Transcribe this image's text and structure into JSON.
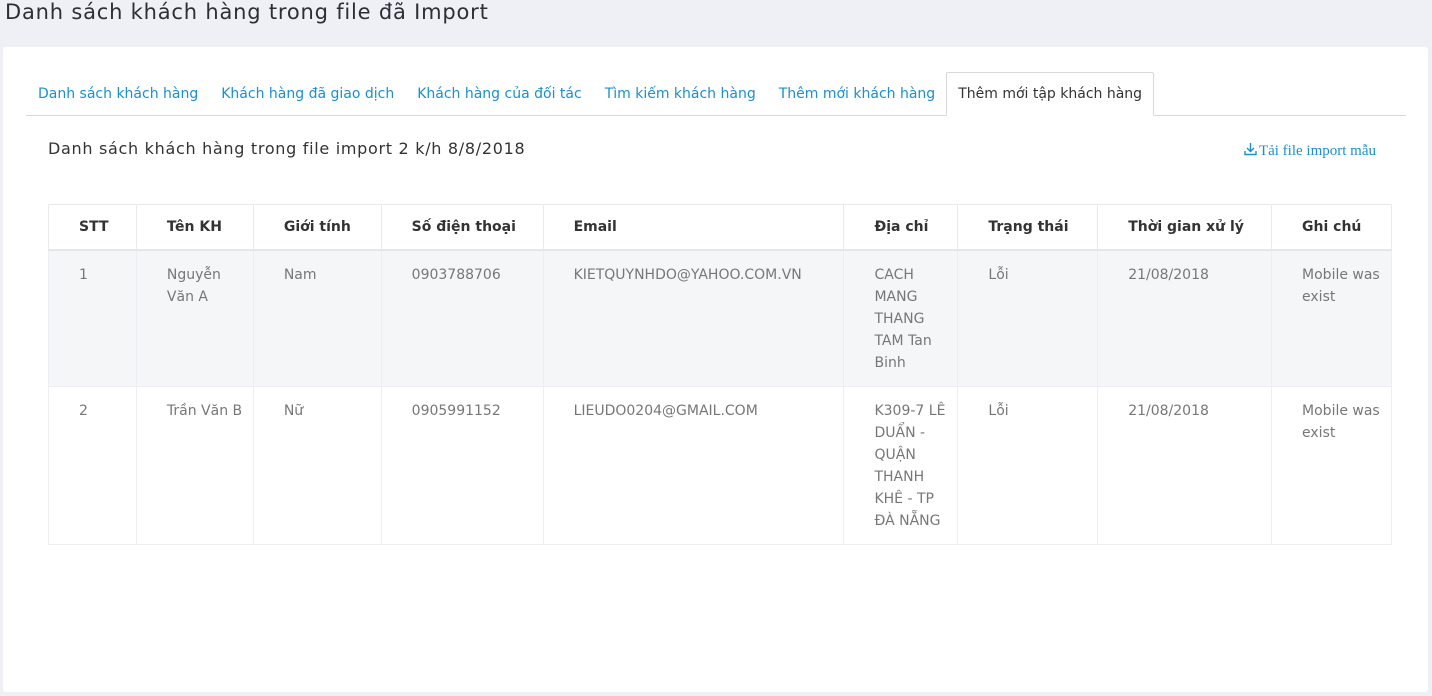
{
  "page_title": "Danh sách khách hàng trong file đã Import",
  "tabs": [
    {
      "label": "Danh sách khách hàng"
    },
    {
      "label": "Khách hàng đã giao dịch"
    },
    {
      "label": "Khách hàng của đối tác"
    },
    {
      "label": "Tìm kiếm khách hàng"
    },
    {
      "label": "Thêm mới khách hàng"
    },
    {
      "label": "Thêm mới tập khách hàng"
    }
  ],
  "subtitle": "Danh sách khách hàng trong file import 2 k/h 8/8/2018",
  "download_link": {
    "label": "Tải file import mẫu",
    "icon": "download-icon"
  },
  "table": {
    "headers": [
      "STT",
      "Tên KH",
      "Giới tính",
      "Số điện thoại",
      "Email",
      "Địa chỉ",
      "Trạng thái",
      "Thời gian xử lý",
      "Ghi chú"
    ],
    "rows": [
      {
        "stt": "1",
        "name": "Nguyễn Văn A",
        "gender": "Nam",
        "phone": "0903788706",
        "email": "KIETQUYNHDO@YAHOO.COM.VN",
        "address": "CACH MANG THANG TAM Tan Binh",
        "status": "Lỗi",
        "processed_at": "21/08/2018",
        "note": "Mobile was exist"
      },
      {
        "stt": "2",
        "name": "Trần Văn B",
        "gender": "Nữ",
        "phone": "0905991152",
        "email": "LIEUDO0204@GMAIL.COM",
        "address": "K309-7 LÊ DUẨN - QUẬN THANH KHÊ - TP ĐÀ NẴNG",
        "status": "Lỗi",
        "processed_at": "21/08/2018",
        "note": "Mobile was exist"
      }
    ]
  },
  "colors": {
    "accent": "#1a8fd1",
    "background": "#eef0f5",
    "row_alt": "#f5f6f8"
  }
}
